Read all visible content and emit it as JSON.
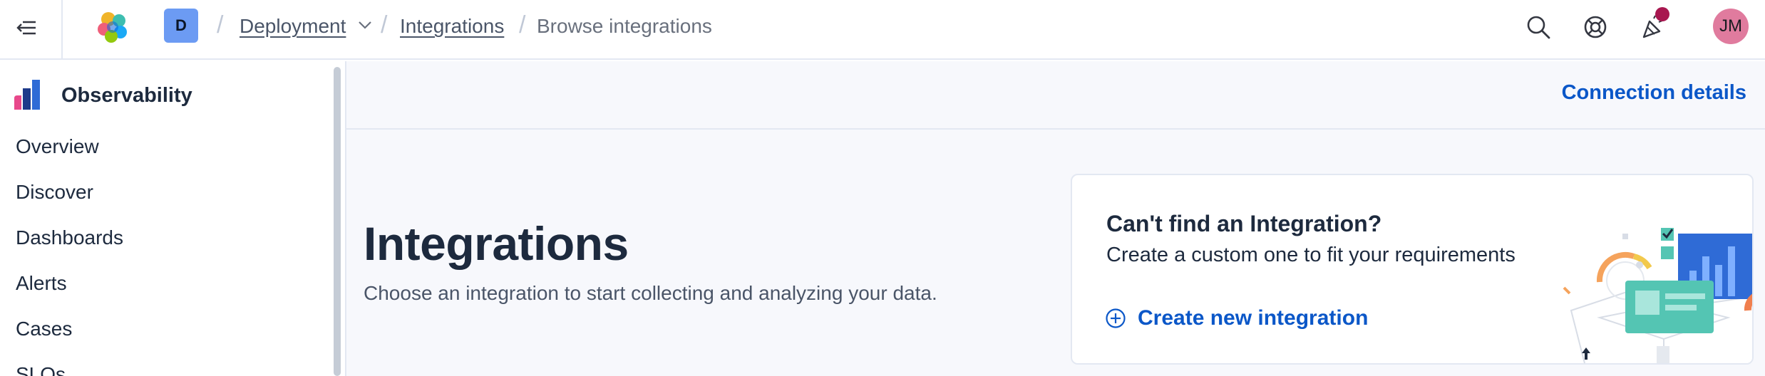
{
  "header": {
    "deployment_initial": "D",
    "breadcrumbs": [
      {
        "label": "Deployment"
      },
      {
        "label": "Integrations"
      },
      {
        "label": "Browse integrations"
      }
    ],
    "user_initials": "JM",
    "icons": [
      "collapse-menu-icon",
      "elastic-logo",
      "search-icon",
      "help-icon",
      "news-feed-icon"
    ]
  },
  "sidebar": {
    "title": "Observability",
    "items": [
      {
        "label": "Overview"
      },
      {
        "label": "Discover"
      },
      {
        "label": "Dashboards"
      },
      {
        "label": "Alerts"
      },
      {
        "label": "Cases"
      },
      {
        "label": "SLOs"
      }
    ]
  },
  "topbar": {
    "connection_details": "Connection details"
  },
  "main": {
    "title": "Integrations",
    "subtitle": "Choose an integration to start collecting and analyzing your data."
  },
  "card": {
    "title": "Can't find an Integration?",
    "text": "Create a custom one to fit your requirements",
    "link": "Create new integration"
  },
  "colors": {
    "link": "#0b57c8",
    "notification_dot": "#a8174f",
    "avatar": "#e07b9e",
    "deployment_avatar": "#6c9bf3",
    "page_background": "#f7f8fc"
  }
}
